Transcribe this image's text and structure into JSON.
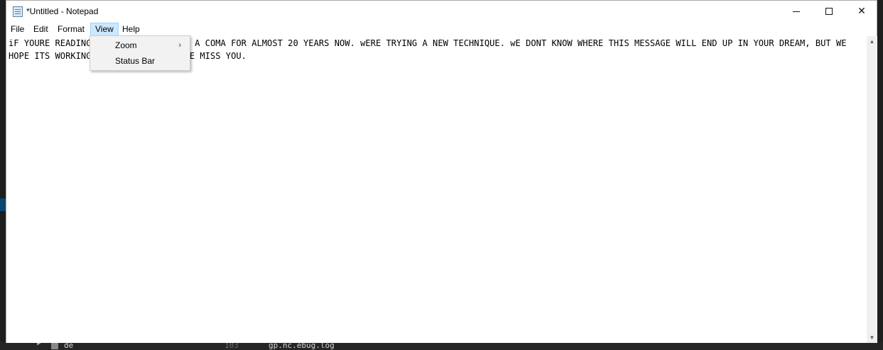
{
  "window": {
    "title": "*Untitled - Notepad",
    "icon": "notepad-icon",
    "controls": {
      "minimize": "minimize-icon",
      "maximize": "maximize-icon",
      "close_glyph": "✕"
    }
  },
  "menubar": {
    "file": "File",
    "edit": "Edit",
    "format": "Format",
    "view": "View",
    "help": "Help",
    "active": "View"
  },
  "view_menu": {
    "zoom": "Zoom",
    "zoom_arrow": "›",
    "status_bar": "Status Bar"
  },
  "editor": {
    "text": "iF YOURE READING THIS YOUVE BEEN IN A COMA FOR ALMOST 20 YEARS NOW. wERE TRYING A NEW TECHNIQUE. wE DONT KNOW WHERE THIS MESSAGE WILL END UP IN YOUR DREAM, BUT WE HOPE ITS WORKING. PLEASE WAKE UP, WE MISS YOU."
  },
  "scrollbar": {
    "up": "▲",
    "down": "▼"
  },
  "background": {
    "line_number": "103",
    "tree_item": "de",
    "file": "gp.nc.ebug.log"
  },
  "colors": {
    "menu_highlight": "#cce8ff",
    "menu_highlight_border": "#99d1ff",
    "dropdown_bg": "#f2f2f2",
    "desktop_bg": "#1e1e1e"
  }
}
